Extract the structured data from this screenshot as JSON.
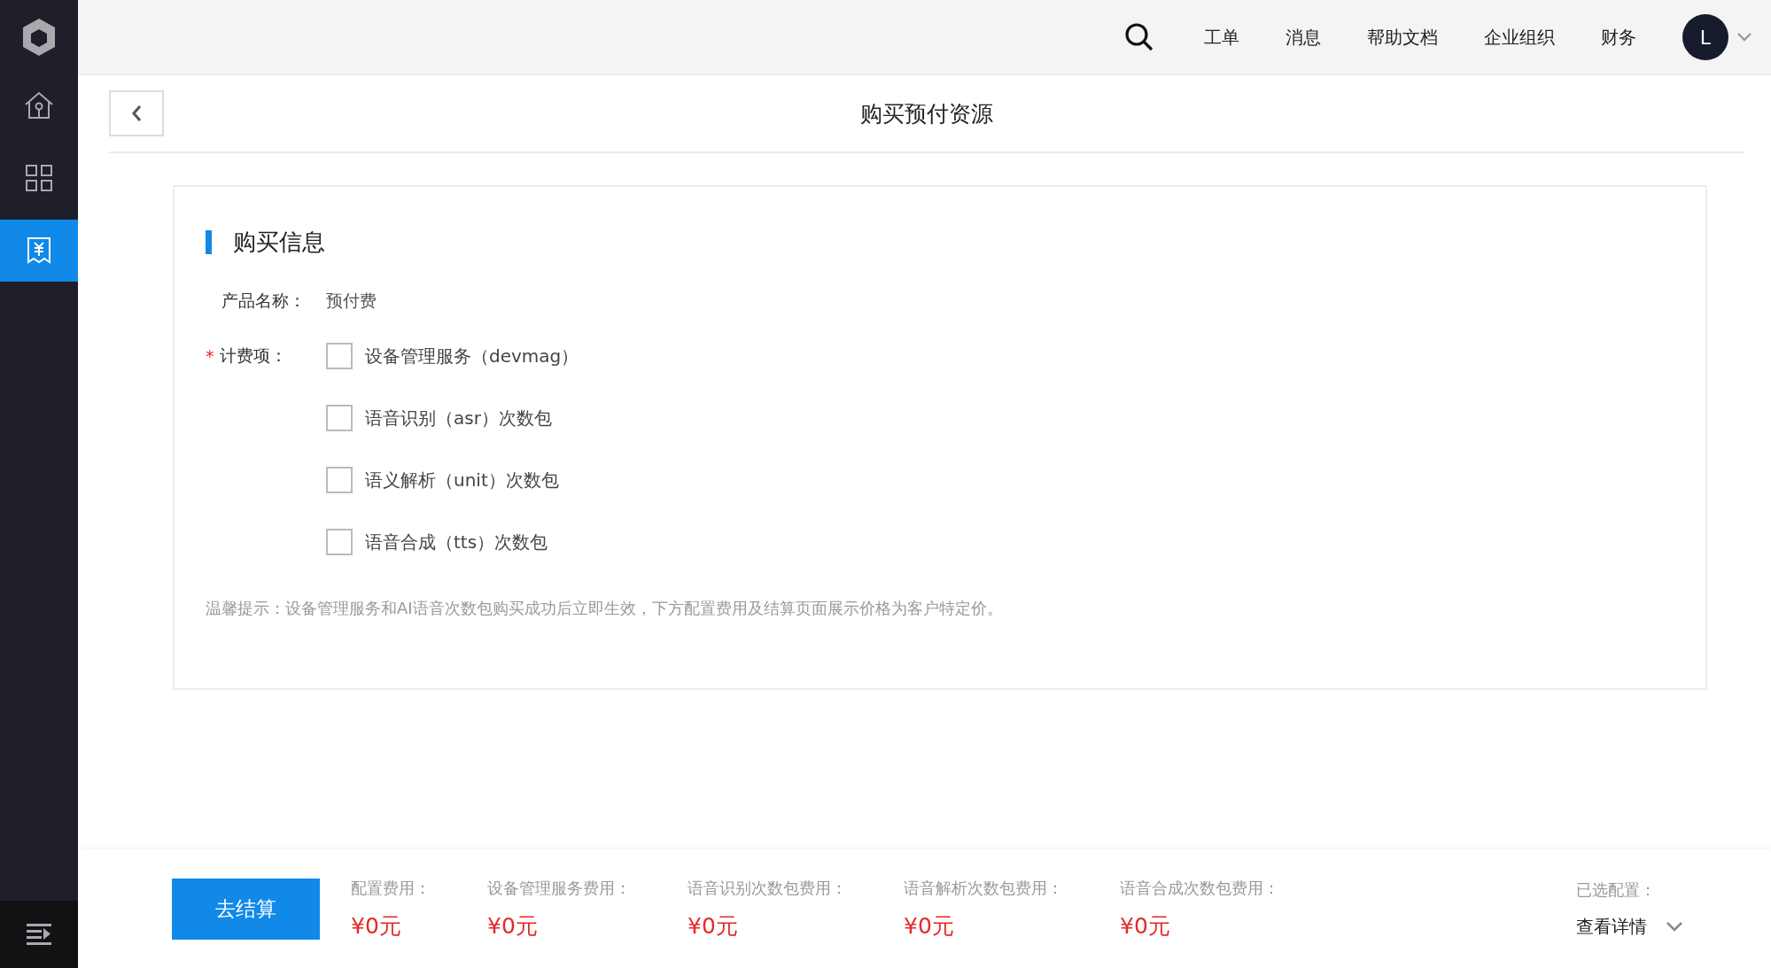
{
  "sidebar": {
    "items": [
      {
        "kind": "home",
        "selected": false
      },
      {
        "kind": "apps",
        "selected": false
      },
      {
        "kind": "billing",
        "selected": true
      }
    ]
  },
  "topbar": {
    "nav": [
      "工单",
      "消息",
      "帮助文档",
      "企业组织",
      "财务"
    ],
    "avatar": "L"
  },
  "page": {
    "title": "购买预付资源"
  },
  "section": {
    "title": "购买信息",
    "product": {
      "label": "产品名称：",
      "value": "预付费"
    },
    "billing": {
      "required_mark": "*",
      "label": "计费项：",
      "options": [
        {
          "label": "设备管理服务（devmag）",
          "checked": false
        },
        {
          "label": "语音识别（asr）次数包",
          "checked": false
        },
        {
          "label": "语义解析（unit）次数包",
          "checked": false
        },
        {
          "label": "语音合成（tts）次数包",
          "checked": false
        }
      ]
    },
    "hint": "温馨提示：设备管理服务和AI语音次数包购买成功后立即生效，下方配置费用及结算页面展示价格为客户特定价。"
  },
  "footer": {
    "checkout": "去结算",
    "fees": [
      {
        "label": "配置费用：",
        "value": "¥0元"
      },
      {
        "label": "设备管理服务费用：",
        "value": "¥0元"
      },
      {
        "label": "语音识别次数包费用：",
        "value": "¥0元"
      },
      {
        "label": "语音解析次数包费用：",
        "value": "¥0元"
      },
      {
        "label": "语音合成次数包费用：",
        "value": "¥0元"
      }
    ],
    "selected_label": "已选配置：",
    "details": "查看详情"
  }
}
